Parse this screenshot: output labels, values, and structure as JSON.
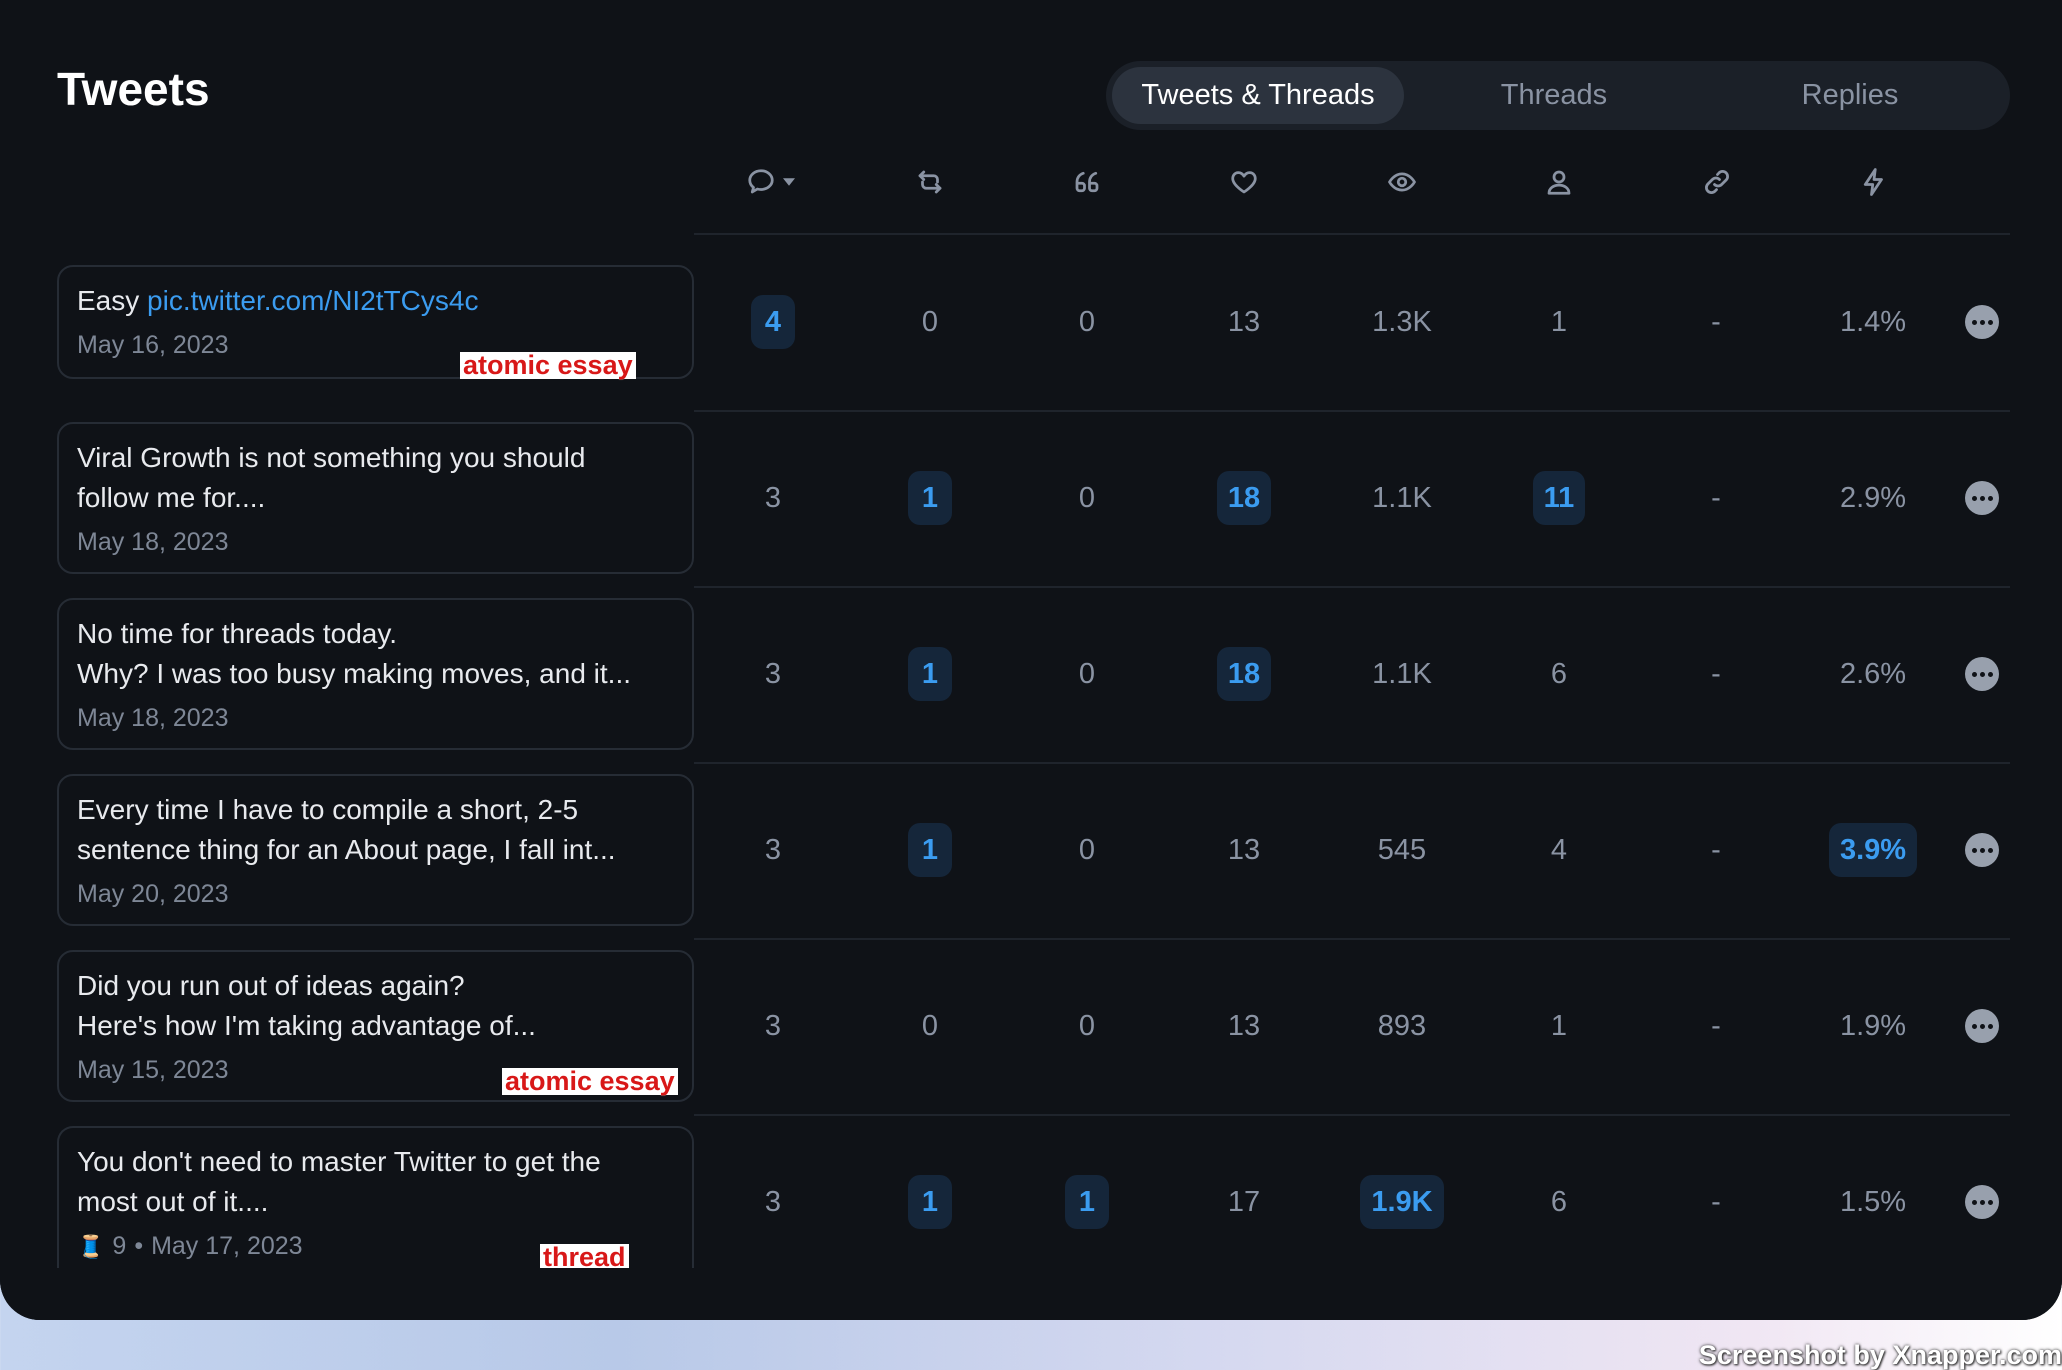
{
  "page": {
    "title": "Tweets"
  },
  "tabs": [
    {
      "label": "Tweets & Threads",
      "active": true
    },
    {
      "label": "Threads",
      "active": false
    },
    {
      "label": "Replies",
      "active": false
    }
  ],
  "columns": [
    "replies-icon",
    "retweets-icon",
    "quotes-icon",
    "likes-icon",
    "impressions-icon",
    "profile-visits-icon",
    "link-clicks-icon",
    "engagement-icon"
  ],
  "tweets": [
    {
      "text": "Easy ",
      "link": "pic.twitter.com/NI2tTCys4c",
      "date": "May 16, 2023",
      "tag": "atomic essay",
      "stats": [
        "4",
        "0",
        "0",
        "13",
        "1.3K",
        "1",
        "-",
        "1.4%"
      ],
      "highlight": [
        true,
        false,
        false,
        false,
        false,
        false,
        false,
        false
      ]
    },
    {
      "text": "Viral Growth is not something you should\nfollow me for....",
      "link": "",
      "date": "May 18, 2023",
      "tag": "",
      "stats": [
        "3",
        "1",
        "0",
        "18",
        "1.1K",
        "11",
        "-",
        "2.9%"
      ],
      "highlight": [
        false,
        true,
        false,
        true,
        false,
        true,
        false,
        false
      ]
    },
    {
      "text": "No time for threads today.\nWhy? I was too busy making moves, and it...",
      "link": "",
      "date": "May 18, 2023",
      "tag": "",
      "stats": [
        "3",
        "1",
        "0",
        "18",
        "1.1K",
        "6",
        "-",
        "2.6%"
      ],
      "highlight": [
        false,
        true,
        false,
        true,
        false,
        false,
        false,
        false
      ]
    },
    {
      "text": "Every time I have to compile a short, 2-5\nsentence thing for an About page, I fall int...",
      "link": "",
      "date": "May 20, 2023",
      "tag": "",
      "stats": [
        "3",
        "1",
        "0",
        "13",
        "545",
        "4",
        "-",
        "3.9%"
      ],
      "highlight": [
        false,
        true,
        false,
        false,
        false,
        false,
        false,
        true
      ]
    },
    {
      "text": "Did you run out of ideas again?\nHere's how I'm taking advantage of...",
      "link": "",
      "date": "May 15, 2023",
      "tag": "atomic essay",
      "stats": [
        "3",
        "0",
        "0",
        "13",
        "893",
        "1",
        "-",
        "1.9%"
      ],
      "highlight": [
        false,
        false,
        false,
        false,
        false,
        false,
        false,
        false
      ]
    },
    {
      "text": "You don't need to master Twitter to get the\nmost out of it....",
      "link": "",
      "date": "May 17, 2023",
      "tag": "thread",
      "thread_count": "9",
      "stats": [
        "3",
        "1",
        "1",
        "17",
        "1.9K",
        "6",
        "-",
        "1.5%"
      ],
      "highlight": [
        false,
        true,
        true,
        false,
        true,
        false,
        false,
        false
      ]
    }
  ],
  "watermark": "Screenshot by Xnapper.com",
  "colors": {
    "background": "#0f1217",
    "accent": "#3b9cf0",
    "tag": "#d81818"
  }
}
